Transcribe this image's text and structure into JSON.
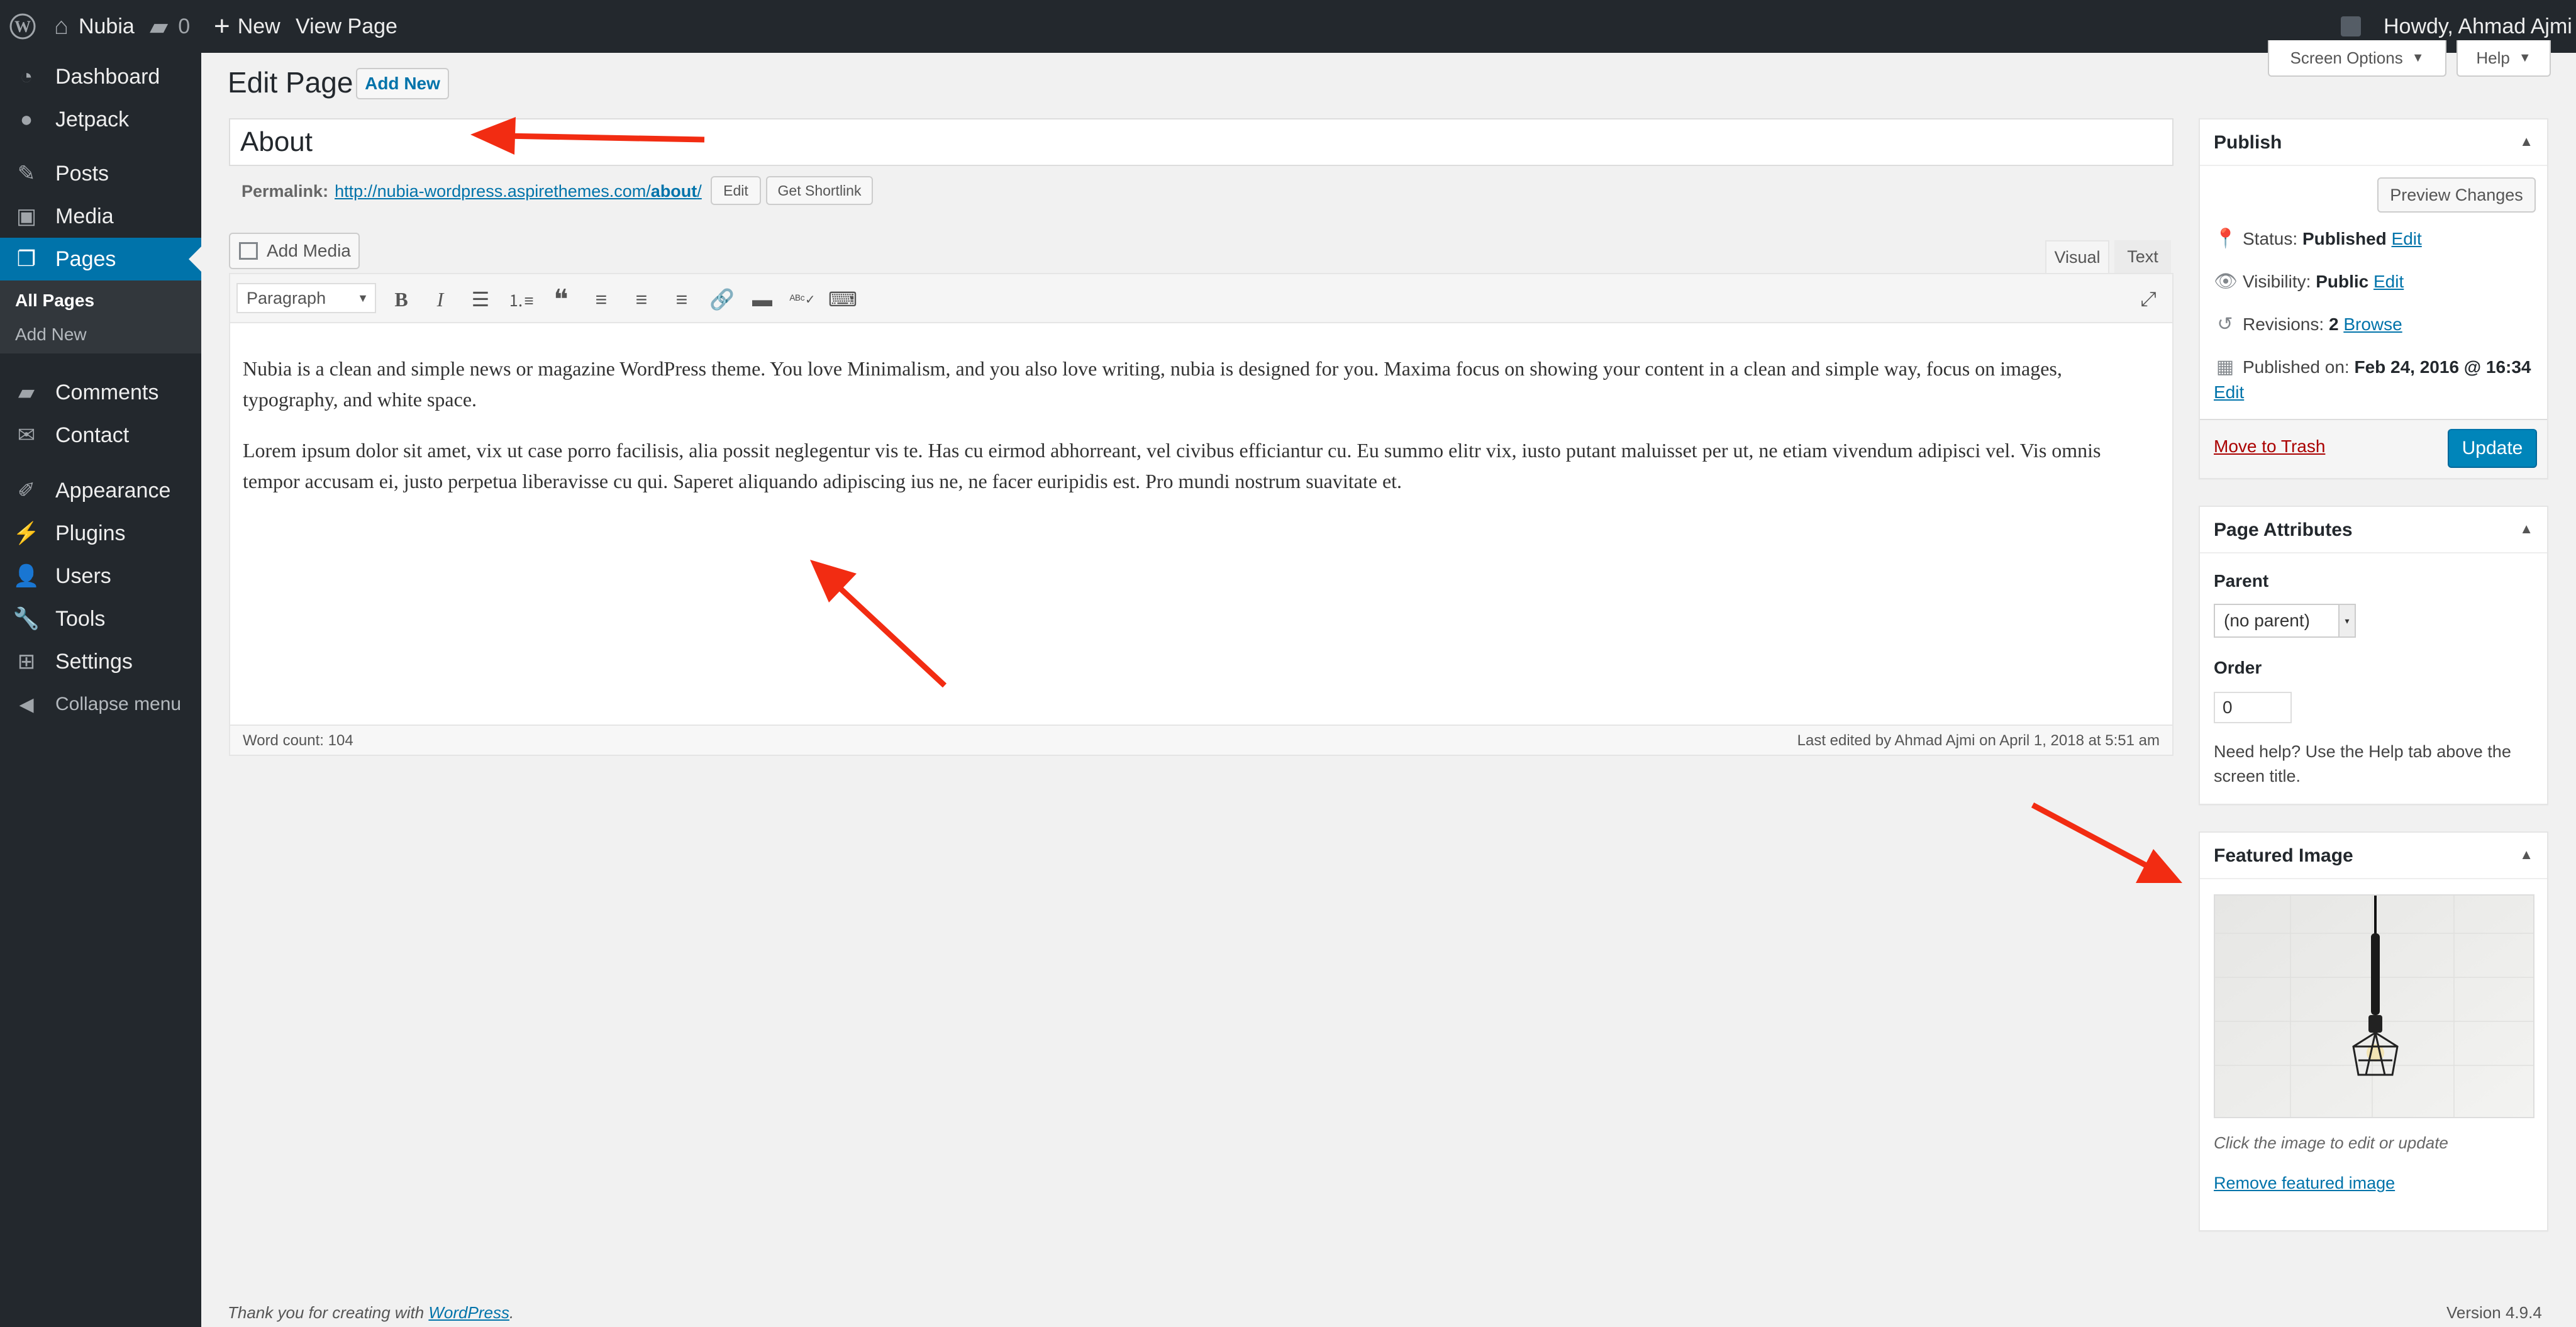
{
  "admin_bar": {
    "site_name": "Nubia",
    "comments_count": "0",
    "new_label": "New",
    "view_page_label": "View Page",
    "howdy": "Howdy, Ahmad Ajmi"
  },
  "sidebar": {
    "items": [
      {
        "label": "Dashboard",
        "icon": "dashboard-icon"
      },
      {
        "label": "Jetpack",
        "icon": "jetpack-icon"
      },
      {
        "label": "Posts",
        "icon": "pin-icon"
      },
      {
        "label": "Media",
        "icon": "media-icon"
      },
      {
        "label": "Pages",
        "icon": "pages-icon"
      },
      {
        "label": "Comments",
        "icon": "comment-icon"
      },
      {
        "label": "Contact",
        "icon": "mail-icon"
      },
      {
        "label": "Appearance",
        "icon": "brush-icon"
      },
      {
        "label": "Plugins",
        "icon": "plugin-icon"
      },
      {
        "label": "Users",
        "icon": "user-icon"
      },
      {
        "label": "Tools",
        "icon": "wrench-icon"
      },
      {
        "label": "Settings",
        "icon": "settings-icon"
      },
      {
        "label": "Collapse menu",
        "icon": "collapse-icon"
      }
    ],
    "submenu": {
      "all_pages": "All Pages",
      "add_new": "Add New"
    }
  },
  "screen_meta": {
    "screen_options": "Screen Options",
    "help": "Help"
  },
  "header": {
    "title": "Edit Page",
    "add_new": "Add New"
  },
  "post": {
    "title": "About",
    "permalink_label": "Permalink:",
    "permalink_base": "http://nubia-wordpress.aspirethemes.com/",
    "permalink_slug": "about",
    "permalink_trail": "/",
    "edit_label": "Edit",
    "shortlink_label": "Get Shortlink"
  },
  "editor": {
    "add_media": "Add Media",
    "tab_visual": "Visual",
    "tab_text": "Text",
    "format_select": "Paragraph",
    "paragraphs": [
      "Nubia is a clean and simple news or magazine WordPress theme. You love Minimalism, and you also love writing, nubia is designed for you. Maxima focus on showing your content in a clean and simple way, focus on images, typography, and white space.",
      "Lorem ipsum dolor sit amet, vix ut case porro facilisis, alia possit neglegentur vis te. Has cu eirmod abhorreant, vel civibus efficiantur cu. Eu summo elitr vix, iusto putant maluisset per ut, ne etiam vivendum adipisci vel. Vis omnis tempor accusam ei, justo perpetua liberavisse cu qui. Saperet aliquando adipiscing ius ne, ne facer euripidis est. Pro mundi nostrum suavitate et."
    ],
    "word_count": "Word count: 104",
    "last_edited": "Last edited by Ahmad Ajmi on April 1, 2018 at 5:51 am"
  },
  "publish": {
    "title": "Publish",
    "preview": "Preview Changes",
    "status_label": "Status:",
    "status_value": "Published",
    "visibility_label": "Visibility:",
    "visibility_value": "Public",
    "revisions_label": "Revisions:",
    "revisions_value": "2",
    "browse": "Browse",
    "published_label": "Published on:",
    "published_value": "Feb 24, 2016 @ 16:34",
    "edit": "Edit",
    "trash": "Move to Trash",
    "update": "Update"
  },
  "page_attributes": {
    "title": "Page Attributes",
    "parent_label": "Parent",
    "parent_value": "(no parent)",
    "order_label": "Order",
    "order_value": "0",
    "help_text": "Need help? Use the Help tab above the screen title."
  },
  "featured_image": {
    "title": "Featured Image",
    "hint": "Click the image to edit or update",
    "remove": "Remove featured image"
  },
  "footer": {
    "thanks_prefix": "Thank you for creating with ",
    "wordpress_link": "WordPress",
    "thanks_suffix": ".",
    "version": "Version 4.9.4"
  },
  "colors": {
    "admin_dark": "#23282d",
    "accent_blue": "#0073aa",
    "primary_button": "#0085ba",
    "annotation_red": "#f22c12",
    "trash_red": "#a00"
  }
}
